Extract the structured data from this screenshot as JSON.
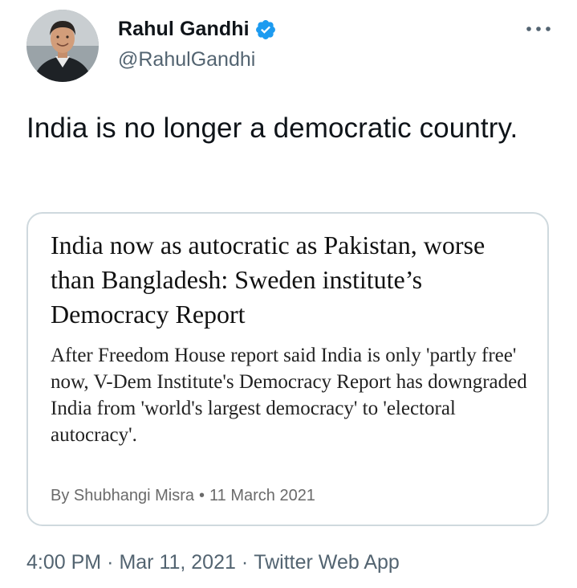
{
  "author": {
    "display_name": "Rahul Gandhi",
    "handle": "@RahulGandhi",
    "verified": true,
    "avatar_icon": "profile-photo"
  },
  "tweet": {
    "text": "India is no longer a democratic country."
  },
  "card": {
    "headline": "India now as autocratic as Pakistan, worse than Bangladesh: Sweden institute’s Democracy Report",
    "summary": "After Freedom House report said India is only 'partly free' now, V-Dem Institute's Democracy Report has downgraded India from 'world's largest democracy' to 'electoral autocracy'.",
    "byline_author": "By Shubhangi Misra",
    "byline_separator": "•",
    "byline_date": "11 March 2021"
  },
  "meta": {
    "time": "4:00 PM",
    "separator": "·",
    "date": "Mar 11, 2021",
    "source": "Twitter Web App"
  },
  "icons": {
    "verified": "verified-badge-icon",
    "more": "more-options-icon"
  },
  "colors": {
    "verified_blue": "#1d9bf0",
    "secondary_text": "#536471",
    "card_border": "#cfd9de"
  }
}
